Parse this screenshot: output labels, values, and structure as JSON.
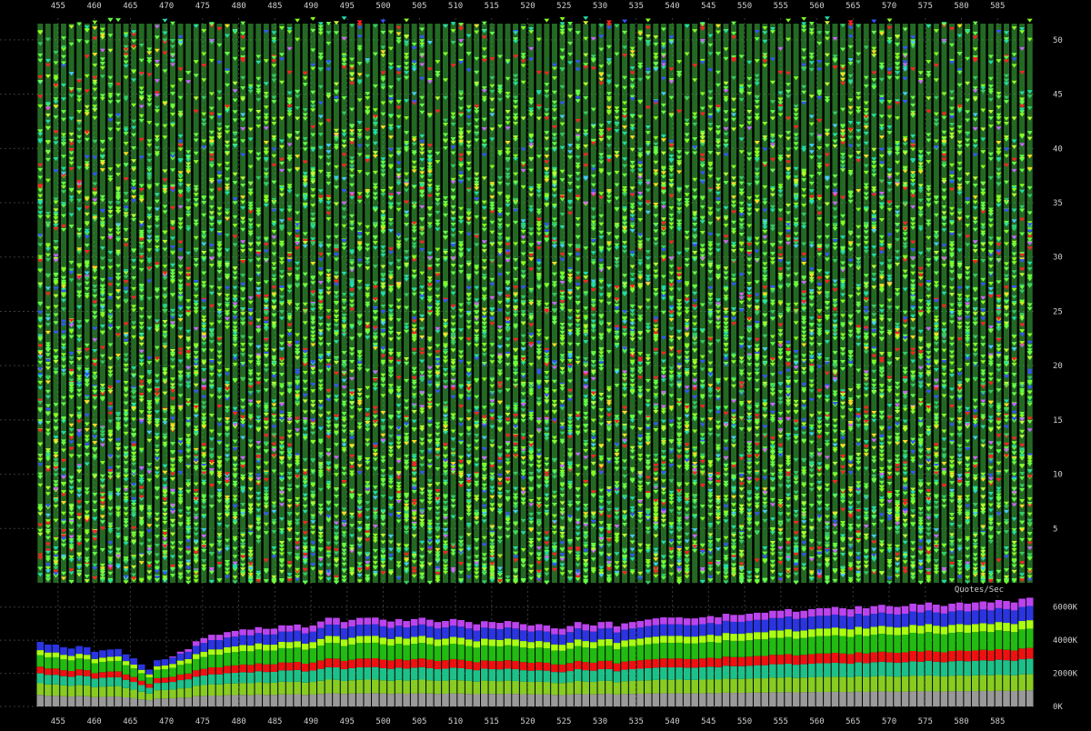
{
  "chart_data": [
    {
      "type": "scatter",
      "title": "",
      "xlabel": "",
      "ylabel": "",
      "x_tick_labels": [
        "455",
        "460",
        "465",
        "470",
        "475",
        "480",
        "485",
        "490",
        "495",
        "500",
        "505",
        "510",
        "515",
        "520",
        "525",
        "530",
        "535",
        "540",
        "545",
        "550",
        "555",
        "560",
        "565",
        "570",
        "575",
        "580",
        "585"
      ],
      "y_tick_labels": [
        "5",
        "10",
        "15",
        "20",
        "25",
        "30",
        "35",
        "40",
        "45",
        "50"
      ],
      "xlim": [
        452,
        590
      ],
      "ylim": [
        0,
        52
      ],
      "grid": true,
      "column_count": 128,
      "marker_colors": [
        "#66ff44",
        "#88ff22",
        "#33cc66",
        "#22ddaa",
        "#bbff33",
        "#ff2222",
        "#3355ff",
        "#cc66ff",
        "#ffdd22",
        "#44ccff"
      ]
    },
    {
      "type": "bar",
      "stacked": true,
      "label": "Quotes/Sec",
      "y_tick_labels": [
        "0K",
        "2000K",
        "4000K",
        "6000K"
      ],
      "ylim": [
        0,
        6700
      ],
      "grid": true,
      "categories_first": 453,
      "series": [
        {
          "color": "#999999",
          "values": [
            700,
            650,
            650,
            620,
            600,
            640,
            620,
            560,
            580,
            600,
            600,
            550,
            500,
            430,
            380,
            480,
            480,
            500,
            530,
            540,
            620,
            640,
            660,
            650,
            680,
            690,
            700,
            680,
            720,
            700,
            700,
            730,
            720,
            740,
            700,
            720,
            760,
            800,
            790,
            760,
            780,
            790,
            800,
            810,
            780,
            760,
            790,
            770,
            790,
            800,
            780,
            760,
            770,
            790,
            780,
            760,
            740,
            770,
            760,
            750,
            770,
            760,
            740,
            730,
            740,
            730,
            700,
            690,
            720,
            760,
            740,
            730,
            760,
            770,
            720,
            750,
            760,
            770,
            780,
            790,
            800,
            790,
            800,
            790,
            790,
            800,
            810,
            800,
            830,
            820,
            820,
            830,
            840,
            840,
            860,
            860,
            870,
            850,
            860,
            870,
            880,
            880,
            890,
            880,
            870,
            900,
            880,
            900,
            910,
            900,
            890,
            900,
            920,
            910,
            930,
            910,
            900,
            920,
            930,
            920,
            930,
            940,
            930,
            950,
            940,
            930,
            960,
            970
          ]
        },
        {
          "color": "#88cc22",
          "values": [
            700,
            680,
            680,
            650,
            640,
            660,
            650,
            600,
            620,
            620,
            630,
            560,
            520,
            460,
            400,
            500,
            510,
            520,
            560,
            580,
            620,
            650,
            680,
            680,
            700,
            700,
            720,
            720,
            740,
            720,
            730,
            760,
            760,
            760,
            740,
            760,
            790,
            820,
            820,
            780,
            800,
            820,
            820,
            820,
            800,
            790,
            810,
            790,
            810,
            820,
            800,
            780,
            790,
            810,
            800,
            780,
            760,
            790,
            780,
            780,
            790,
            780,
            760,
            750,
            760,
            750,
            720,
            720,
            740,
            780,
            760,
            750,
            780,
            780,
            740,
            770,
            780,
            790,
            800,
            810,
            820,
            820,
            820,
            810,
            810,
            820,
            830,
            820,
            850,
            840,
            840,
            850,
            860,
            860,
            880,
            880,
            890,
            870,
            880,
            890,
            900,
            900,
            910,
            900,
            890,
            920,
            900,
            920,
            930,
            920,
            910,
            920,
            940,
            930,
            950,
            930,
            920,
            940,
            950,
            940,
            950,
            960,
            950,
            970,
            960,
            950,
            980,
            990
          ]
        },
        {
          "color": "#1ec08a",
          "values": [
            600,
            580,
            580,
            560,
            550,
            570,
            560,
            520,
            530,
            540,
            540,
            500,
            460,
            400,
            350,
            440,
            450,
            460,
            500,
            520,
            560,
            580,
            600,
            610,
            630,
            640,
            650,
            650,
            670,
            660,
            660,
            690,
            690,
            700,
            670,
            690,
            720,
            750,
            750,
            710,
            730,
            750,
            750,
            750,
            730,
            720,
            740,
            720,
            740,
            750,
            730,
            710,
            720,
            740,
            730,
            710,
            690,
            720,
            710,
            710,
            720,
            710,
            690,
            680,
            690,
            680,
            660,
            660,
            680,
            710,
            690,
            680,
            710,
            710,
            670,
            700,
            710,
            720,
            730,
            740,
            750,
            750,
            750,
            740,
            740,
            750,
            760,
            750,
            780,
            770,
            770,
            780,
            790,
            790,
            810,
            810,
            820,
            800,
            810,
            820,
            830,
            830,
            840,
            830,
            820,
            850,
            830,
            850,
            860,
            850,
            840,
            850,
            870,
            860,
            880,
            860,
            850,
            870,
            880,
            870,
            880,
            890,
            880,
            900,
            890,
            880,
            910,
            920
          ]
        },
        {
          "color": "#ee1111",
          "values": [
            400,
            380,
            380,
            360,
            350,
            370,
            360,
            330,
            340,
            350,
            350,
            320,
            300,
            260,
            230,
            290,
            300,
            310,
            340,
            350,
            380,
            400,
            420,
            420,
            440,
            450,
            460,
            460,
            470,
            460,
            460,
            480,
            480,
            490,
            470,
            480,
            510,
            530,
            530,
            500,
            510,
            530,
            530,
            530,
            520,
            510,
            520,
            510,
            520,
            530,
            520,
            500,
            510,
            520,
            510,
            500,
            480,
            500,
            500,
            500,
            510,
            500,
            490,
            480,
            490,
            480,
            460,
            460,
            480,
            500,
            490,
            480,
            500,
            500,
            470,
            490,
            500,
            510,
            520,
            520,
            530,
            530,
            530,
            520,
            520,
            530,
            540,
            530,
            550,
            550,
            550,
            550,
            560,
            560,
            570,
            570,
            580,
            560,
            570,
            580,
            590,
            590,
            600,
            590,
            580,
            600,
            590,
            600,
            610,
            600,
            600,
            600,
            620,
            610,
            620,
            610,
            600,
            620,
            620,
            620,
            620,
            630,
            620,
            640,
            630,
            620,
            650,
            660
          ]
        },
        {
          "color": "#22bb11",
          "values": [
            700,
            680,
            680,
            650,
            640,
            660,
            650,
            600,
            620,
            620,
            630,
            560,
            520,
            460,
            400,
            500,
            510,
            540,
            580,
            600,
            680,
            720,
            760,
            760,
            790,
            800,
            820,
            820,
            840,
            830,
            830,
            860,
            860,
            870,
            840,
            860,
            900,
            940,
            940,
            900,
            920,
            940,
            940,
            940,
            920,
            900,
            930,
            910,
            930,
            940,
            920,
            900,
            910,
            930,
            920,
            900,
            880,
            910,
            900,
            890,
            910,
            900,
            880,
            870,
            880,
            870,
            840,
            830,
            860,
            900,
            880,
            870,
            900,
            910,
            860,
            890,
            900,
            910,
            930,
            940,
            950,
            950,
            950,
            940,
            940,
            950,
            960,
            950,
            990,
            980,
            980,
            990,
            1000,
            1000,
            1020,
            1020,
            1040,
            1010,
            1020,
            1040,
            1050,
            1050,
            1060,
            1050,
            1040,
            1070,
            1050,
            1070,
            1080,
            1070,
            1060,
            1070,
            1100,
            1090,
            1110,
            1090,
            1080,
            1100,
            1110,
            1100,
            1110,
            1120,
            1110,
            1140,
            1130,
            1110,
            1150,
            1160
          ]
        },
        {
          "color": "#aaff11",
          "values": [
            300,
            290,
            290,
            280,
            270,
            280,
            280,
            260,
            260,
            270,
            270,
            250,
            230,
            200,
            180,
            220,
            230,
            240,
            260,
            270,
            300,
            310,
            330,
            330,
            340,
            350,
            360,
            360,
            370,
            360,
            360,
            380,
            380,
            380,
            370,
            380,
            400,
            420,
            420,
            400,
            410,
            420,
            420,
            420,
            410,
            400,
            410,
            400,
            410,
            420,
            410,
            400,
            400,
            410,
            410,
            400,
            390,
            400,
            400,
            390,
            400,
            400,
            390,
            380,
            390,
            380,
            370,
            370,
            380,
            400,
            390,
            380,
            400,
            400,
            380,
            390,
            400,
            400,
            410,
            420,
            420,
            420,
            420,
            420,
            420,
            420,
            430,
            420,
            440,
            430,
            430,
            440,
            440,
            440,
            450,
            450,
            460,
            450,
            450,
            460,
            460,
            460,
            470,
            460,
            460,
            470,
            460,
            470,
            480,
            470,
            470,
            470,
            480,
            480,
            490,
            480,
            470,
            480,
            490,
            480,
            490,
            490,
            490,
            500,
            500,
            490,
            510,
            510
          ]
        },
        {
          "color": "#2a35e0",
          "values": [
            500,
            480,
            480,
            460,
            450,
            470,
            460,
            430,
            440,
            440,
            450,
            410,
            380,
            330,
            290,
            360,
            370,
            390,
            420,
            440,
            500,
            530,
            560,
            560,
            580,
            590,
            600,
            600,
            620,
            610,
            610,
            630,
            630,
            640,
            620,
            630,
            660,
            690,
            690,
            660,
            680,
            690,
            690,
            690,
            680,
            660,
            680,
            670,
            680,
            690,
            680,
            660,
            670,
            680,
            670,
            660,
            640,
            670,
            660,
            650,
            670,
            660,
            640,
            630,
            640,
            630,
            610,
            600,
            630,
            660,
            640,
            630,
            660,
            660,
            630,
            650,
            660,
            670,
            680,
            690,
            700,
            700,
            700,
            690,
            690,
            700,
            710,
            700,
            730,
            720,
            720,
            730,
            740,
            740,
            750,
            750,
            770,
            740,
            750,
            770,
            770,
            770,
            780,
            770,
            760,
            790,
            770,
            790,
            800,
            790,
            780,
            790,
            810,
            800,
            820,
            800,
            790,
            810,
            820,
            810,
            820,
            830,
            820,
            840,
            830,
            820,
            850,
            860
          ]
        },
        {
          "color": "#bb44ee",
          "values": [
            0,
            0,
            0,
            0,
            0,
            0,
            0,
            0,
            0,
            0,
            0,
            0,
            0,
            0,
            0,
            0,
            0,
            60,
            120,
            160,
            280,
            300,
            320,
            320,
            330,
            340,
            350,
            350,
            360,
            350,
            350,
            370,
            370,
            370,
            360,
            370,
            390,
            410,
            410,
            390,
            400,
            410,
            410,
            410,
            400,
            390,
            400,
            390,
            400,
            410,
            400,
            390,
            390,
            400,
            400,
            390,
            380,
            390,
            390,
            380,
            390,
            390,
            380,
            370,
            380,
            370,
            360,
            360,
            370,
            390,
            380,
            370,
            390,
            390,
            370,
            380,
            390,
            390,
            400,
            410,
            410,
            410,
            410,
            410,
            410,
            410,
            420,
            410,
            430,
            420,
            420,
            430,
            430,
            430,
            440,
            440,
            450,
            440,
            440,
            450,
            450,
            450,
            460,
            450,
            450,
            460,
            450,
            460,
            470,
            460,
            460,
            460,
            470,
            470,
            480,
            470,
            460,
            470,
            480,
            470,
            480,
            480,
            480,
            490,
            490,
            480,
            500,
            500
          ]
        }
      ]
    }
  ]
}
